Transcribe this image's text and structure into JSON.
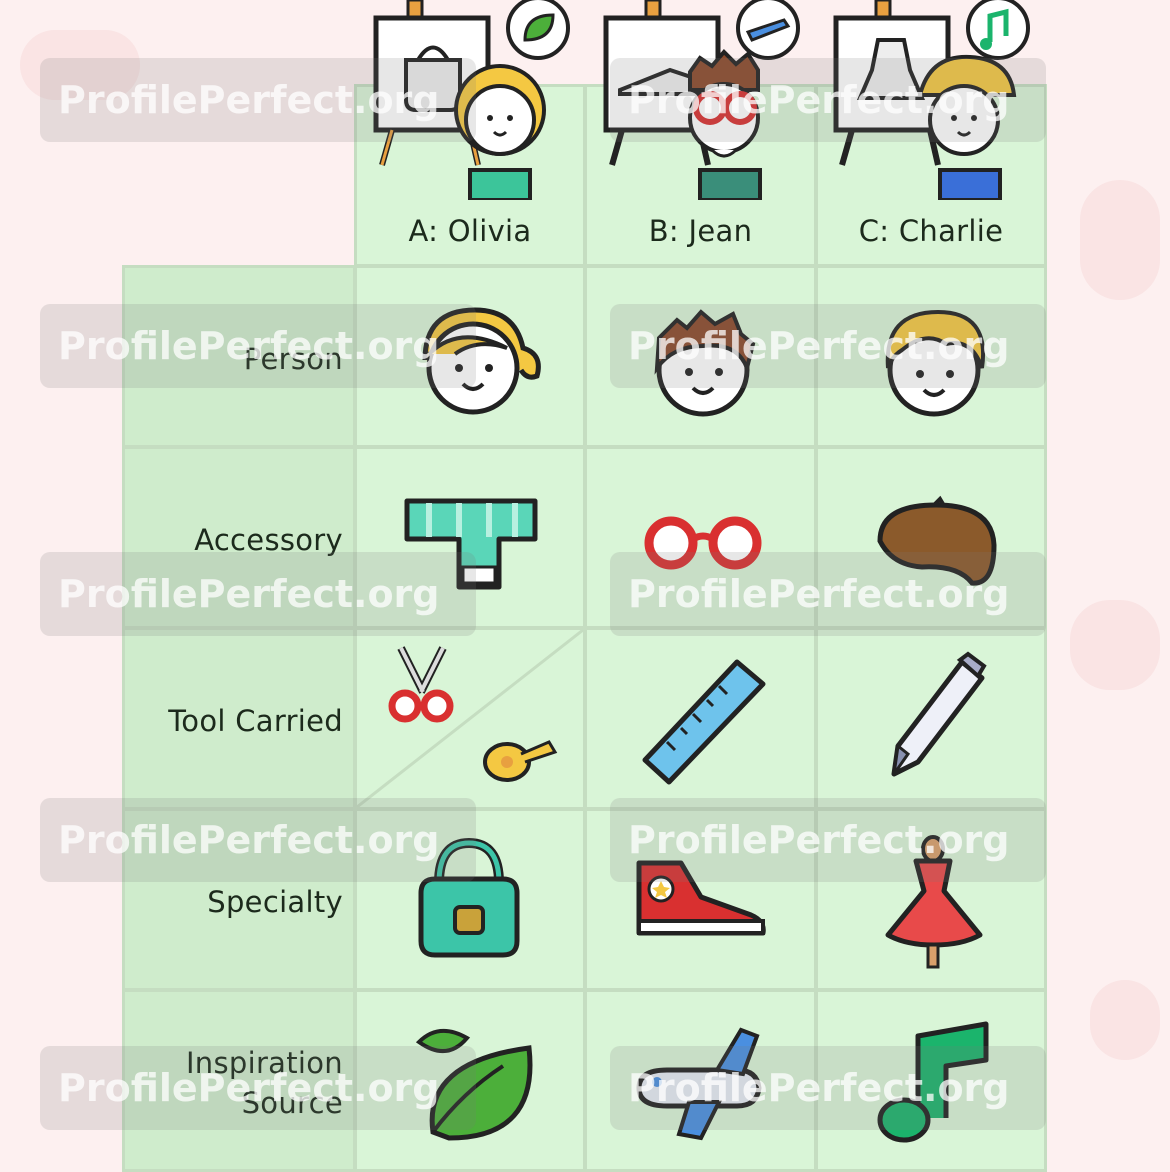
{
  "puzzle": {
    "columns": [
      "A: Olivia",
      "B: Jean",
      "C: Charlie"
    ],
    "rows": [
      {
        "label": "Person"
      },
      {
        "label": "Accessory"
      },
      {
        "label": "Tool Carried"
      },
      {
        "label": "Specialty"
      },
      {
        "label": "Inspiration",
        "label2": "Source"
      }
    ],
    "cells": {
      "person": [
        "girl-blonde-ponytail-icon",
        "boy-brown-hair-icon",
        "boy-blonde-hair-icon"
      ],
      "accessory": [
        "scarf-icon",
        "glasses-icon",
        "beret-icon"
      ],
      "tool": [
        "scissors-and-tape-measure-icon",
        "ruler-icon",
        "pen-icon"
      ],
      "specialty": [
        "handbag-icon",
        "sneaker-icon",
        "dress-icon"
      ],
      "inspiration": [
        "leaf-icon",
        "airplane-icon",
        "music-note-icon"
      ]
    }
  },
  "watermark": "ProfilePerfect.org",
  "colors": {
    "cell_bg": "#d9f5d7",
    "grid_line": "#c5ddc1",
    "page_bg": "#fdf0f0",
    "text": "#1c2a1c"
  }
}
